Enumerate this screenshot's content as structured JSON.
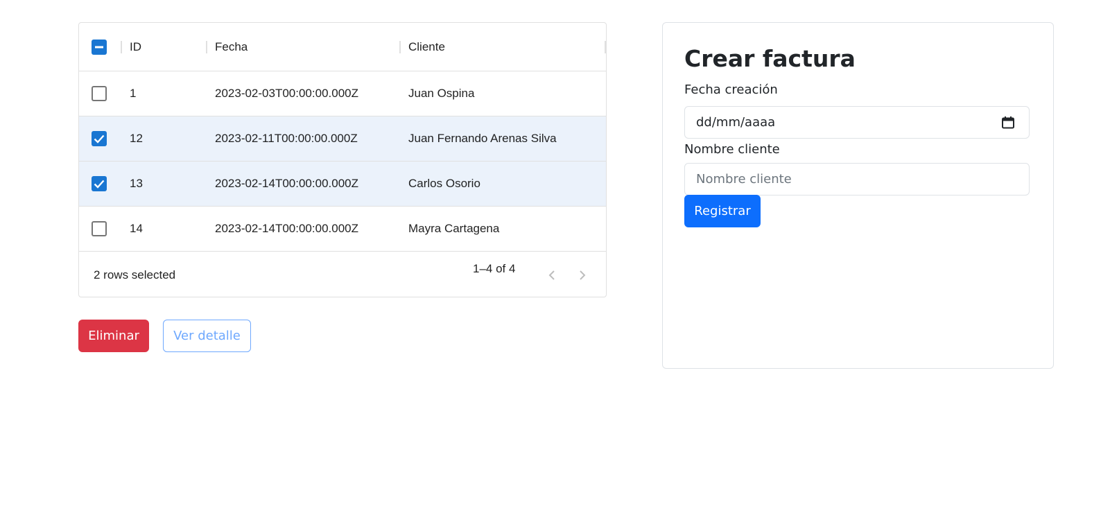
{
  "grid": {
    "columns": [
      {
        "label": "ID"
      },
      {
        "label": "Fecha"
      },
      {
        "label": "Cliente"
      }
    ],
    "rows": [
      {
        "id": "1",
        "fecha": "2023-02-03T00:00:00.000Z",
        "cliente": "Juan Ospina",
        "selected": false
      },
      {
        "id": "12",
        "fecha": "2023-02-11T00:00:00.000Z",
        "cliente": "Juan Fernando Arenas Silva",
        "selected": true
      },
      {
        "id": "13",
        "fecha": "2023-02-14T00:00:00.000Z",
        "cliente": "Carlos Osorio",
        "selected": true
      },
      {
        "id": "14",
        "fecha": "2023-02-14T00:00:00.000Z",
        "cliente": "Mayra Cartagena",
        "selected": false
      }
    ],
    "selected_text": "2 rows selected",
    "pagination": "1–4 of 4"
  },
  "actions": {
    "delete_label": "Eliminar",
    "detail_label": "Ver detalle"
  },
  "form": {
    "title": "Crear factura",
    "date_label": "Fecha creación",
    "date_value": "dd/mm/aaaa",
    "client_label": "Nombre cliente",
    "client_placeholder": "Nombre cliente",
    "submit_label": "Registrar"
  },
  "colors": {
    "checkbox_checked": "#1976d2",
    "row_selected": "#ebf2fb",
    "danger": "#dc3545",
    "primary": "#0d6efd",
    "outline": "#6ea8fe"
  },
  "icons": [
    "checkbox-indeterminate-icon",
    "checkbox-checked-icon",
    "checkbox-unchecked-icon",
    "calendar-icon",
    "chevron-left-icon",
    "chevron-right-icon"
  ]
}
